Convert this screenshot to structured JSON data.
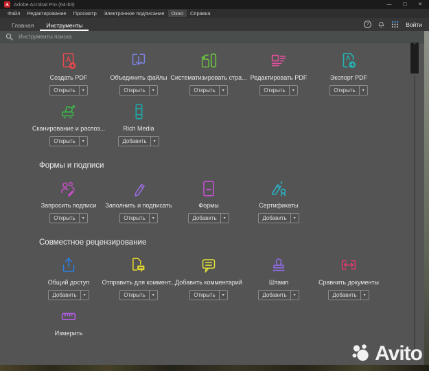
{
  "window": {
    "title": "Adobe Acrobat Pro (64-bit)"
  },
  "icons": {
    "minimize": "—",
    "maximize": "▢",
    "close": "✕",
    "help": "?",
    "dropdown": "▾"
  },
  "menu": {
    "items": [
      "Файл",
      "Редактирование",
      "Просмотр",
      "Электронное подписание",
      "Окно",
      "Справка"
    ],
    "highlighted": "Окно"
  },
  "tabs": [
    {
      "label": "Главная",
      "active": false
    },
    {
      "label": "Инструменты",
      "active": true
    }
  ],
  "header": {
    "sign_in": "Войти"
  },
  "search": {
    "placeholder": "Инструменты поиска"
  },
  "sections": [
    {
      "title": "",
      "tools": [
        {
          "id": "create-pdf",
          "label": "Создать PDF",
          "button": "Открыть",
          "color": "#e5494d"
        },
        {
          "id": "combine-files",
          "label": "Объединить файлы",
          "button": "Открыть",
          "color": "#7b80e0"
        },
        {
          "id": "organize-pages",
          "label": "Систематизировать стра...",
          "button": "Открыть",
          "color": "#6cc93e"
        },
        {
          "id": "edit-pdf",
          "label": "Редактировать PDF",
          "button": "Открыть",
          "color": "#e9509e"
        },
        {
          "id": "export-pdf",
          "label": "Экспорт PDF",
          "button": "Открыть",
          "color": "#23b5b5"
        },
        {
          "id": "scan-ocr",
          "label": "Сканирование и распоз...",
          "button": "Открыть",
          "color": "#3db84b"
        },
        {
          "id": "rich-media",
          "label": "Rich Media",
          "button": "Добавить",
          "color": "#1fa8a8"
        }
      ]
    },
    {
      "title": "Формы и подписи",
      "tools": [
        {
          "id": "request-signatures",
          "label": "Запросить подписи",
          "button": "Открыть",
          "color": "#c44fc4"
        },
        {
          "id": "fill-sign",
          "label": "Заполнить и подписать",
          "button": "Открыть",
          "color": "#9b6ce0"
        },
        {
          "id": "forms",
          "label": "Формы",
          "button": "Добавить",
          "color": "#c44fd0"
        },
        {
          "id": "certificates",
          "label": "Сертификаты",
          "button": "Добавить",
          "color": "#2ab5c9"
        }
      ]
    },
    {
      "title": "Совместное рецензирование",
      "tools": [
        {
          "id": "share",
          "label": "Общий доступ",
          "button": "Добавить",
          "color": "#2d7fe0"
        },
        {
          "id": "send-comments",
          "label": "Отправить для коммент...",
          "button": "Открыть",
          "color": "#e0d32e"
        },
        {
          "id": "add-comment",
          "label": "Добавить комментарий",
          "button": "Открыть",
          "color": "#dedc3a"
        },
        {
          "id": "stamp",
          "label": "Штамп",
          "button": "Добавить",
          "color": "#8f6ae8"
        },
        {
          "id": "compare",
          "label": "Сравнить документы",
          "button": "Добавить",
          "color": "#e03a6e"
        },
        {
          "id": "measure",
          "label": "Измерить",
          "button": null,
          "color": "#b45ce8"
        }
      ]
    }
  ],
  "watermark": {
    "text": "Avito"
  }
}
